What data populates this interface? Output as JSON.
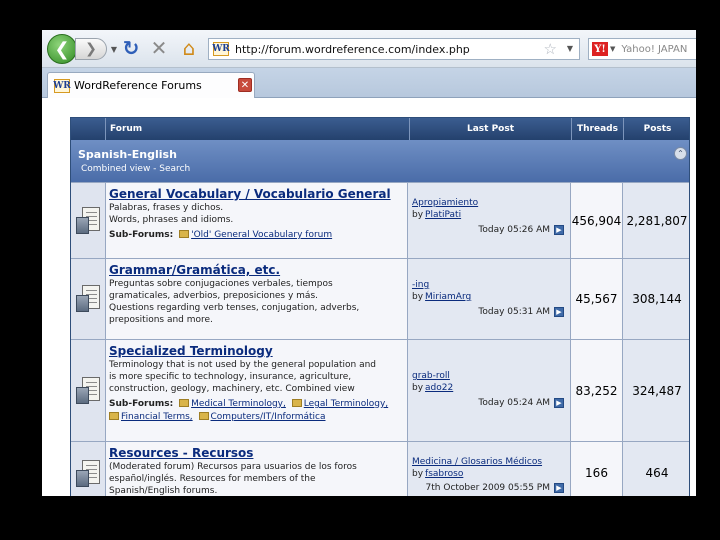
{
  "browser": {
    "url": "http://forum.wordreference.com/index.php",
    "search_engine_placeholder": "Yahoo! JAPAN",
    "tab_title": "WordReference Forums",
    "favicon_text": "WR",
    "yahoo_icon_text": "Y!"
  },
  "table": {
    "headers": {
      "forum": "Forum",
      "last_post": "Last Post",
      "threads": "Threads",
      "posts": "Posts"
    },
    "category": {
      "title": "Spanish-English",
      "combined_view": "Combined view",
      "separator": " - ",
      "search": "Search"
    }
  },
  "forums": [
    {
      "title": "General Vocabulary / Vocabulario General",
      "desc": [
        "Palabras, frases y dichos.",
        "Words, phrases and idioms."
      ],
      "subforums_label": "Sub-Forums:",
      "subforums": [
        "'Old' General Vocabulary forum"
      ],
      "last_thread": "Apropiamiento",
      "last_by": "by",
      "last_user": "PlatiPati",
      "last_time": "Today 05:26 AM",
      "threads": "456,904",
      "posts": "2,281,807"
    },
    {
      "title": "Grammar/Gramática, etc.",
      "desc": [
        "Preguntas sobre conjugaciones verbales, tiempos",
        "gramaticales, adverbios, preposiciones y más.",
        "Questions regarding verb tenses, conjugation, adverbs,",
        "prepositions and more."
      ],
      "last_thread": "-ing",
      "last_by": "by",
      "last_user": "MiriamArg",
      "last_time": "Today 05:31 AM",
      "threads": "45,567",
      "posts": "308,144"
    },
    {
      "title": "Specialized Terminology",
      "desc": [
        "Terminology that is not used by the general population and",
        "is more specific to technology, insurance, agriculture,",
        "construction, geology, machinery, etc.  Combined view"
      ],
      "subforums_label": "Sub-Forums:",
      "subforums": [
        "Medical Terminology,",
        "Legal Terminology,",
        "Financial Terms,",
        "Computers/IT/Informática"
      ],
      "last_thread": "grab-roll",
      "last_by": "by",
      "last_user": "ado22",
      "last_time": "Today 05:24 AM",
      "threads": "83,252",
      "posts": "324,487"
    },
    {
      "title": "Resources - Recursos",
      "desc": [
        "(Moderated forum) Recursos para usuarios de los foros",
        "español/inglés. Resources for members of the",
        "Spanish/English forums."
      ],
      "last_thread": "Medicina / Glosarios Médicos",
      "last_by": "by",
      "last_user": "fsabroso",
      "last_time": "7th October 2009 05:55 PM",
      "threads": "166",
      "posts": "464"
    }
  ]
}
